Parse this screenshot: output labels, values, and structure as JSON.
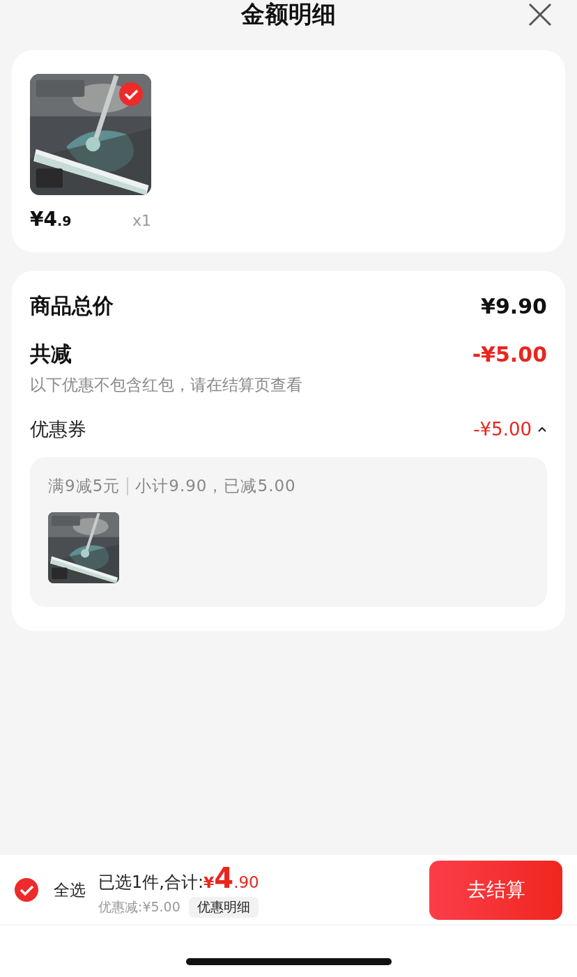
{
  "header": {
    "title": "金额明细"
  },
  "products": [
    {
      "kind": "picture",
      "selected": true,
      "price": {
        "symbol": "¥",
        "integer": "4",
        "decimal": ".9"
      },
      "quantity": "x1"
    }
  ],
  "summary": {
    "total_label": "商品总价",
    "total_value": "¥9.90",
    "discount_label": "共减",
    "discount_value": "-¥5.00",
    "note": "以下优惠不包含红包，请在结算页查看",
    "coupon": {
      "label": "优惠券",
      "value": "-¥5.00",
      "expanded": true,
      "rule": "满9减5元",
      "detail": "小计9.90，已减5.00"
    }
  },
  "checkout": {
    "select_all": {
      "label": "全选",
      "checked": true
    },
    "summary": "已选1件,合计:",
    "symbol": "¥",
    "integer": "4",
    "decimal": ".90",
    "discount": "优惠减:¥5.00",
    "detail_button": "优惠明细",
    "submit": "去结算"
  }
}
